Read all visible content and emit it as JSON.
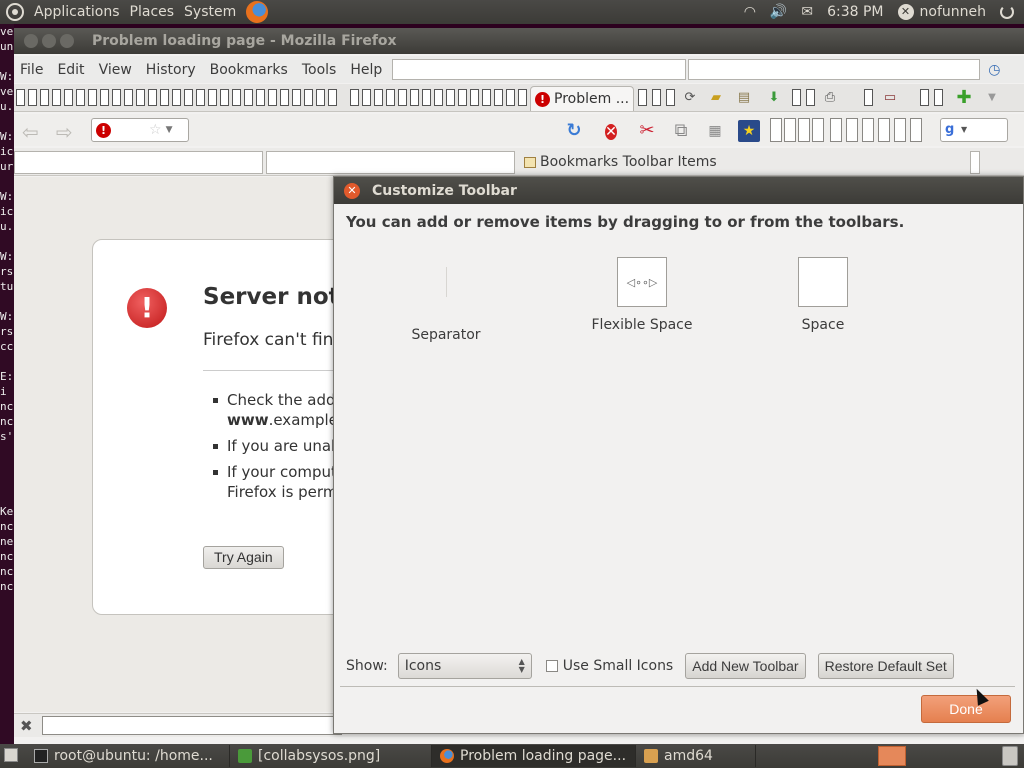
{
  "top_panel": {
    "menus": [
      "Applications",
      "Places",
      "System"
    ],
    "clock": "6:38 PM",
    "user": "nofunneh"
  },
  "terminal_lines": [
    "ve",
    "un",
    "",
    "W:",
    "ve",
    "u.",
    "",
    "W:",
    "ic",
    "ur",
    "",
    "W:",
    "ic",
    "u.",
    "",
    "W:",
    "rs",
    "tu",
    "",
    "W:",
    "rs",
    "cc",
    "",
    "E:",
    " i",
    "nc",
    "nc",
    "s'",
    "",
    "",
    "",
    "",
    "Ke",
    "nc",
    "ne",
    "nc",
    "nc",
    "nc"
  ],
  "window": {
    "title": "Problem loading page - Mozilla Firefox"
  },
  "menubar": [
    "File",
    "Edit",
    "View",
    "History",
    "Bookmarks",
    "Tools",
    "Help"
  ],
  "tab": {
    "label": "Problem ..."
  },
  "bookmarks_bar": {
    "label": "Bookmarks Toolbar Items"
  },
  "error_page": {
    "title": "Server not f",
    "short": "Firefox can't fin",
    "bullets": [
      {
        "line1": "Check the addr",
        "line2_bold": "www",
        "line2": ".example"
      },
      {
        "line1": "If you are unab"
      },
      {
        "line1": "If your comput",
        "line2": "Firefox is perm"
      }
    ],
    "try_again": "Try Again"
  },
  "dialog": {
    "title": "Customize Toolbar",
    "instructions": "You can add or remove items by dragging to or from the toolbars.",
    "palette": [
      "Separator",
      "Flexible Space",
      "Space"
    ],
    "show_label": "Show:",
    "show_value": "Icons",
    "small_icons_label": "Use Small Icons",
    "small_icons_checked": false,
    "add_toolbar": "Add New Toolbar",
    "restore_default": "Restore Default Set",
    "done": "Done"
  },
  "taskbar": [
    {
      "icon": "terminal-icon",
      "label": "root@ubuntu: /home..."
    },
    {
      "icon": "image-icon",
      "label": "[collabsysos.png]"
    },
    {
      "icon": "firefox-icon",
      "label": "Problem loading page..."
    },
    {
      "icon": "folder-icon",
      "label": "amd64"
    }
  ],
  "colors": {
    "panel": "#3c3b37",
    "done_button": "#e5804f",
    "error_red": "#cc0000"
  }
}
